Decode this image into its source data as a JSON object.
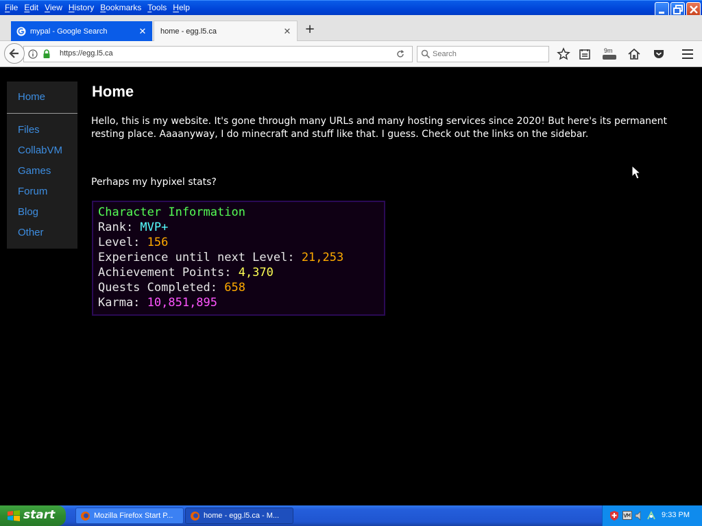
{
  "menubar": {
    "items": [
      "File",
      "Edit",
      "View",
      "History",
      "Bookmarks",
      "Tools",
      "Help"
    ]
  },
  "tabs": [
    {
      "title": "mypal - Google Search",
      "favicon": "google-icon",
      "active": false
    },
    {
      "title": "home - egg.l5.ca",
      "favicon": "none",
      "active": true
    }
  ],
  "navbar": {
    "url": "https://egg.l5.ca",
    "search_placeholder": "Search",
    "timer_badge": "9m"
  },
  "sidebar": {
    "items": [
      "Home",
      "Files",
      "CollabVM",
      "Games",
      "Forum",
      "Blog",
      "Other"
    ]
  },
  "page": {
    "heading": "Home",
    "intro": "Hello, this is my website. It's gone through many URLs and many hosting services since 2020! But here's its permanent resting place. Aaaanyway, I do minecraft and stuff like that. I guess. Check out the links on the sidebar.",
    "stats_prompt": "Perhaps my hypixel stats?",
    "character": {
      "title": "Character Information",
      "rows": [
        {
          "label": "Rank: ",
          "value": "MVP+"
        },
        {
          "label": "Level: ",
          "value": "156"
        },
        {
          "label": "Experience until next Level: ",
          "value": "21,253"
        },
        {
          "label": "Achievement Points: ",
          "value": "4,370"
        },
        {
          "label": "Quests Completed: ",
          "value": "658"
        },
        {
          "label": "Karma: ",
          "value": "10,851,895"
        }
      ]
    }
  },
  "taskbar": {
    "start_label": "start",
    "items": [
      "Mozilla Firefox Start P...",
      "home - egg.l5.ca - M..."
    ],
    "clock": "9:33 PM"
  },
  "colors": {
    "link": "#3d8de0",
    "title_green": "#55ff55",
    "rank_aqua": "#55ffff",
    "level_gold": "#ffaa00",
    "achievement_yellow": "#ffff55",
    "karma_pink": "#ff55ff"
  }
}
